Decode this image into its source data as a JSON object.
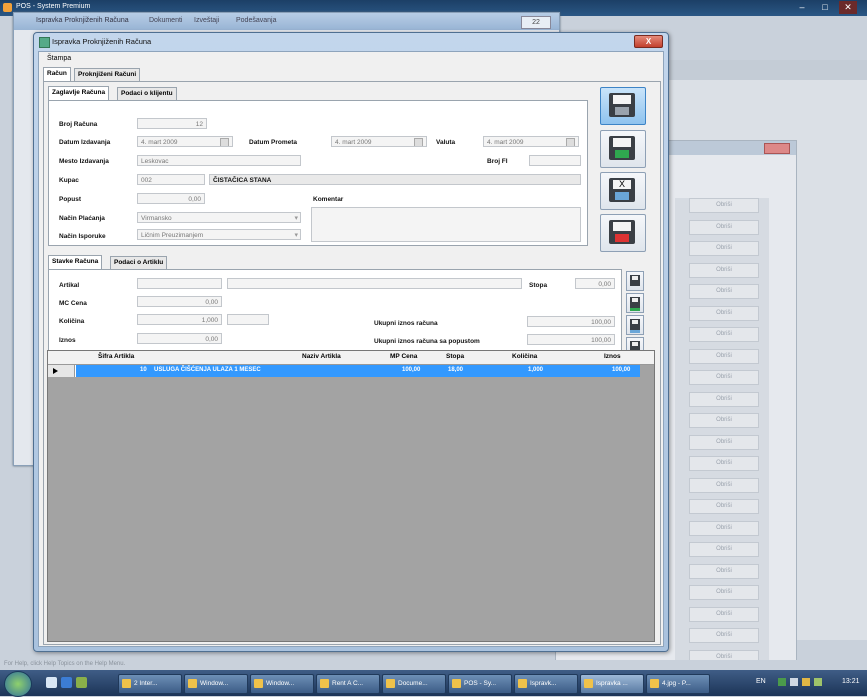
{
  "app": {
    "title": "POS - System Premium"
  },
  "background_window": {
    "title": "Ispravka Proknjiženih Računa",
    "menu": [
      "Dokumenti",
      "Izveštaji",
      "Podešavanja"
    ],
    "close_label": "22"
  },
  "background_grid": {
    "button_label": "Obriši",
    "count": 22
  },
  "window": {
    "title": "Ispravka Proknjiženih Računa",
    "close_label": "X",
    "menu": {
      "stampa": "Štampa"
    },
    "tabs": {
      "racun": "Račun",
      "proknjizeni": "Proknjiženi Računi"
    }
  },
  "header_section": {
    "tabs": {
      "zaglavlje": "Zaglavlje Računa",
      "klijent": "Podaci o klijentu"
    },
    "labels": {
      "broj": "Broj Računa",
      "datum_izdavanja": "Datum Izdavanja",
      "datum_prometa": "Datum Prometa",
      "valuta": "Valuta",
      "mesto": "Mesto Izdavanja",
      "broj_fi": "Broj FI",
      "kupac": "Kupac",
      "popust": "Popust",
      "komentar": "Komentar",
      "nacin_placanja": "Način Plaćanja",
      "nacin_isporuke": "Način Isporuke"
    },
    "values": {
      "broj": "12",
      "datum_izdavanja": "4.    mart    2009",
      "datum_prometa": "4.    mart    2009",
      "valuta": "4.    mart    2009",
      "mesto": "Leskovac",
      "broj_fi": "",
      "kupac_code": "002",
      "kupac_name": "ČISTAČICA STANA",
      "popust": "0,00",
      "komentar": "",
      "nacin_placanja": "Virmansko",
      "nacin_isporuke": "Ličnim Preuzimanjem"
    }
  },
  "items_section": {
    "tabs": {
      "stavke": "Stavke Računa",
      "artikl": "Podaci o Artiklu"
    },
    "labels": {
      "artikal": "Artikal",
      "mc_cena": "MC Cena",
      "kolicina": "Količina",
      "iznos": "Iznos",
      "stopa": "Stopa",
      "ukupni": "Ukupni iznos računa",
      "ukupni_popust": "Ukupni iznos računa sa popustom"
    },
    "values": {
      "artikal_code": "",
      "artikal_name": "",
      "mc_cena": "0,00",
      "kolicina": "1,000",
      "kolicina_unit": "",
      "iznos": "0,00",
      "stopa": "0,00",
      "ukupni": "100,00",
      "ukupni_popust": "100,00"
    }
  },
  "table": {
    "columns": [
      "Šifra Artikla",
      "Naziv Artikla",
      "MP Cena",
      "Stopa",
      "Količina",
      "Iznos"
    ],
    "rows": [
      [
        "10",
        "USLUGA ČIŠĆENJA ULAZA 1 MESEC",
        "100,00",
        "18,00",
        "1,000",
        "100,00"
      ]
    ]
  },
  "status": {
    "text": "For Help, click Help Topics on the Help Menu."
  },
  "taskbar": {
    "items": [
      "2 Inter...",
      "Window...",
      "Window...",
      "Rent A C...",
      "Docume...",
      "POS - Sy...",
      "Ispravk...",
      "Ispravka ...",
      "4.jpg - P..."
    ],
    "lang": "EN",
    "time": "13:21"
  }
}
